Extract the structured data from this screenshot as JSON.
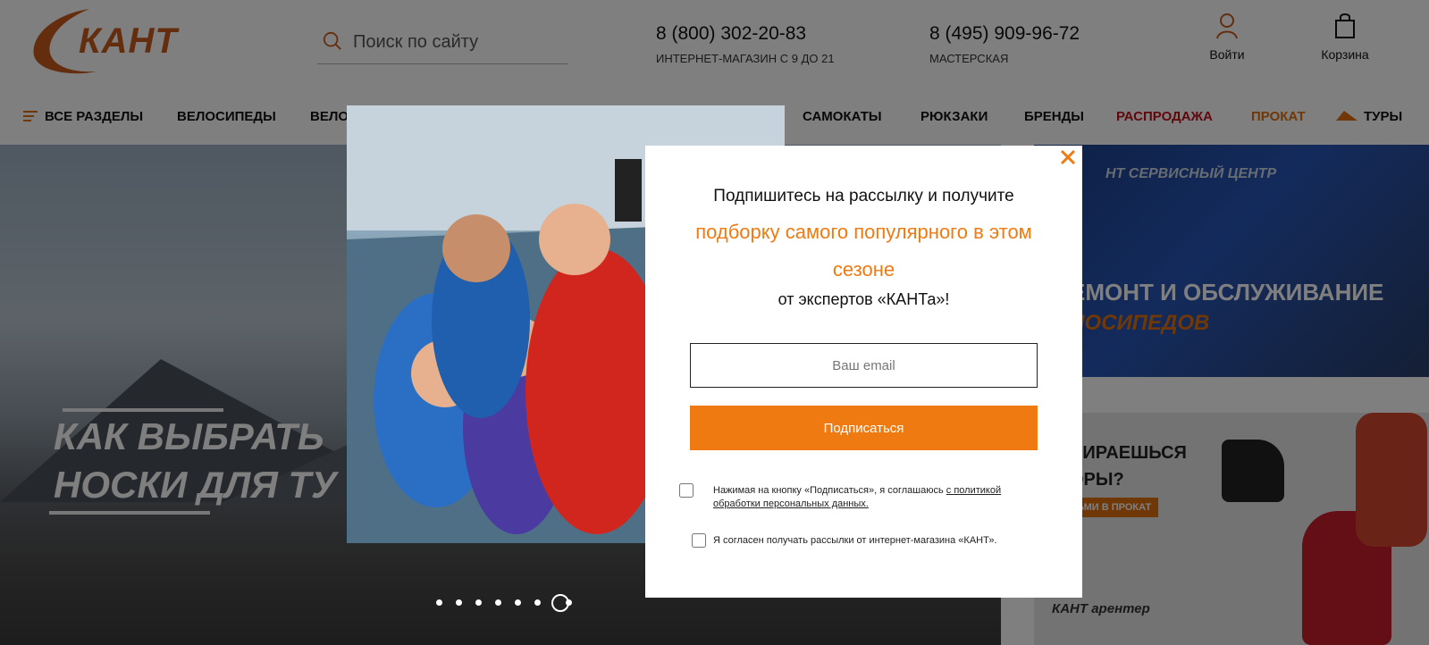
{
  "header": {
    "logo_text": "КАНТ",
    "search_placeholder": "Поиск по сайту",
    "phone1": "8 (800) 302-20-83",
    "phone1_note": "ИНТЕРНЕТ-МАГАЗИН С 9 ДО 21",
    "phone2": "8 (495) 909-96-72",
    "phone2_note": "МАСТЕРСКАЯ",
    "login_label": "Войти",
    "cart_label": "Корзина"
  },
  "nav": {
    "all_sections": "ВСЕ РАЗДЕЛЫ",
    "items": [
      "ВЕЛОСИПЕДЫ",
      "ВЕЛО",
      "САМОКАТЫ",
      "РЮКЗАКИ",
      "БРЕНДЫ"
    ],
    "sale": "РАСПРОДАЖА",
    "rent": "ПРОКАТ",
    "tours": "ТУРЫ"
  },
  "hero": {
    "title_line1": "КАК ВЫБРАТЬ",
    "title_line2": "НОСКИ ДЛЯ ТУ",
    "slides_count": 8,
    "active_slide": 7
  },
  "banner_service": {
    "tag": "НТ СЕРВИСНЫЙ ЦЕНТР",
    "title": "ЕМОНТ И ОБСЛУЖИВАНИЕ",
    "subtitle": "ЛОСИПЕДОВ"
  },
  "banner_rent": {
    "title_line1": "БИРАЕШЬСЯ",
    "title_line2": "ОРЫ?",
    "pill": "ЬМИ В ПРОКАТ",
    "logos": "КАНТ  арентер"
  },
  "modal": {
    "line1": "Подпишитесь на рассылку и получите",
    "highlight": "подборку самого популярного в этом сезоне",
    "line3": "от экспертов «КАНТа»!",
    "email_placeholder": "Ваш email",
    "submit_label": "Подписаться",
    "consent_text": "Нажимая на кнопку «Подписаться», я соглашаюсь ",
    "consent_link": "с политикой обработки персональных данных.",
    "newsletter_text": "Я согласен получать рассылки от интернет-магазина «КАНТ».",
    "close_glyph": "✕"
  },
  "colors": {
    "accent": "#f07a12",
    "sale": "#c0121a",
    "overlay": "rgba(0,0,0,0.5)"
  }
}
